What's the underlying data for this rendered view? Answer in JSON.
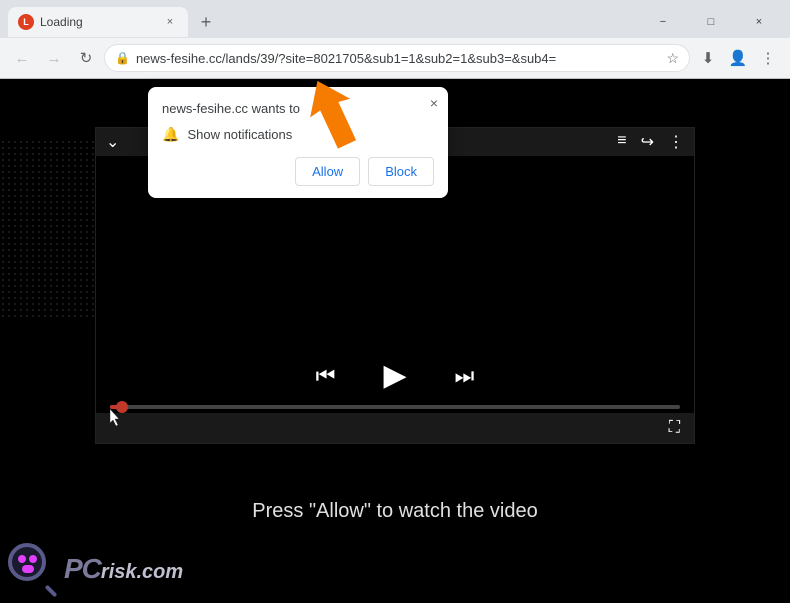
{
  "browser": {
    "tab": {
      "favicon_label": "L",
      "title": "Loading",
      "close_label": "×"
    },
    "new_tab_label": "+",
    "window_controls": {
      "minimize": "−",
      "maximize": "□",
      "close": "×"
    },
    "address_bar": {
      "back": "←",
      "forward": "→",
      "reload": "↻",
      "url": "news-fesihe.cc/lands/39/?site=8021705&sub1=1&sub2=1&sub3=&sub4=",
      "star": "☆",
      "profile_icon": "👤",
      "menu_icon": "⋮",
      "download_icon": "⬇"
    }
  },
  "notification_popup": {
    "title": "news-fesihe.cc wants to",
    "close": "×",
    "notification_label": "Show notifications",
    "allow_label": "Allow",
    "block_label": "Block"
  },
  "video_player": {
    "prev_label": "⏮",
    "play_label": "▶",
    "next_label": "⏭",
    "fullscreen_label": "⛶",
    "queue_label": "≡",
    "share_label": "↪",
    "more_label": "⋮",
    "chevron_down": "⌄"
  },
  "page": {
    "press_allow_text": "Press \"Allow\" to watch the video"
  },
  "pcrisk": {
    "logo_text": "risk.com",
    "prefix": "PC"
  }
}
